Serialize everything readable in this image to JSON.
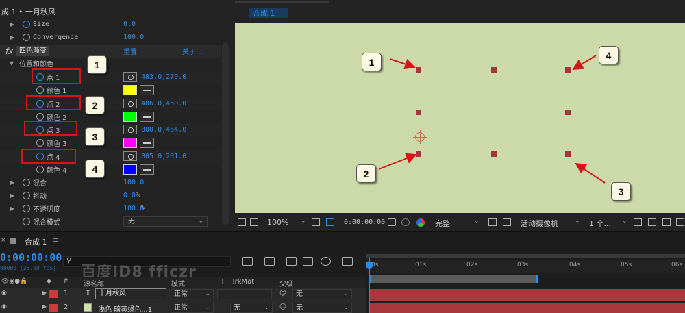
{
  "effect_panel": {
    "title": "成 1 • 十月秋风",
    "size_label": "Size",
    "size_value": "0.0",
    "convergence_label": "Convergence",
    "convergence_value": "100.0",
    "effect_name": "四色渐变",
    "reset_label": "重置",
    "about_label": "关于...",
    "group_label": "位置和颜色",
    "points": [
      {
        "label": "点 1",
        "value": "483.0,279.0",
        "color_label": "颜色 1",
        "color": "#ffff00"
      },
      {
        "label": "点 2",
        "value": "486.0,460.0",
        "color_label": "颜色 2",
        "color": "#00ff00"
      },
      {
        "label": "点 3",
        "value": "800.0,464.0",
        "color_label": "颜色 3",
        "color": "#ff00ff"
      },
      {
        "label": "点 4",
        "value": "805.0,281.0",
        "color_label": "颜色 4",
        "color": "#0000ff"
      }
    ],
    "blend_label": "混合",
    "blend_value": "100.0",
    "jitter_label": "抖动",
    "jitter_value": "0.0",
    "jitter_unit": "%",
    "opacity_label": "不透明度",
    "opacity_value": "100.0",
    "opacity_unit": "%",
    "blend_mode_label": "混合模式",
    "blend_mode_value": "无"
  },
  "badges": [
    "1",
    "2",
    "3",
    "4"
  ],
  "viewer": {
    "tab_label": "合成 1",
    "canvas_color": "#ccdaaa",
    "zoom": "100%",
    "timecode": "0:00:00:00",
    "quality": "完整",
    "camera": "活动摄像机",
    "views": "1 个..."
  },
  "timeline": {
    "tab_label": "合成 1",
    "timecode": "0:00:00:00",
    "fps": "00000 (25.00 fps)",
    "watermark": "百度ID8 fficzr",
    "columns": {
      "name": "源名称",
      "mode": "模式",
      "t": "T",
      "trkmat": "TrkMat",
      "parent": "父级"
    },
    "ruler_ticks": [
      "0s",
      "01s",
      "02s",
      "03s",
      "04s",
      "05s",
      "06s"
    ],
    "layers": [
      {
        "num": "1",
        "type_icon": "T",
        "name": "十月秋风",
        "mode": "正常",
        "trkmat": "",
        "parent": "无",
        "color": "#c83c3c"
      },
      {
        "num": "2",
        "type_icon": "",
        "name": "浅色 暗黄绿色...1",
        "mode": "正常",
        "trkmat": "无",
        "parent": "无",
        "color": "#c83c3c"
      }
    ]
  }
}
